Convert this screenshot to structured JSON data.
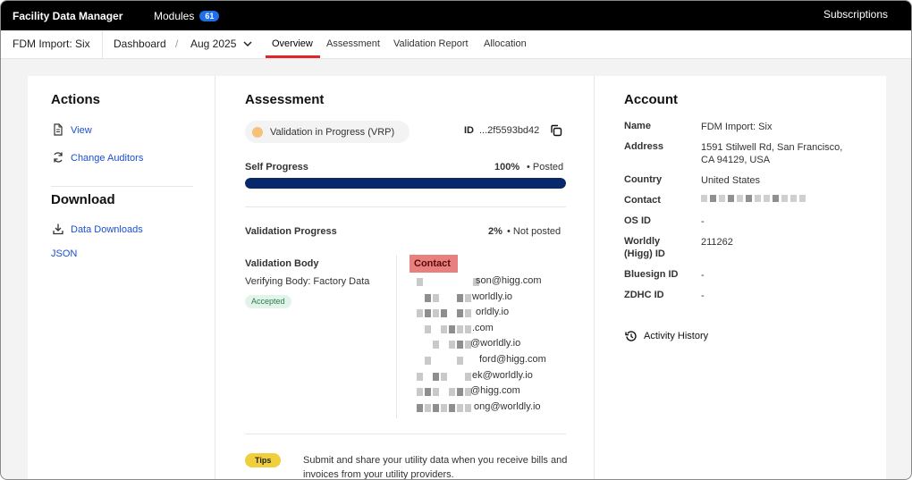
{
  "topbar": {
    "brand": "Facility Data Manager",
    "modules_label": "Modules",
    "modules_count": "61",
    "subscriptions": "Subscriptions"
  },
  "nav": {
    "facility": "FDM Import: Six",
    "dashboard": "Dashboard",
    "separator": "/",
    "month": "Aug 2025",
    "tabs": [
      {
        "label": "Overview"
      },
      {
        "label": "Assessment"
      },
      {
        "label": "Validation Report"
      },
      {
        "label": "Allocation"
      }
    ]
  },
  "actions": {
    "title": "Actions",
    "view": "View",
    "change_auditors": "Change Auditors"
  },
  "download": {
    "title": "Download",
    "data_downloads": "Data Downloads",
    "json": "JSON"
  },
  "assessment": {
    "title": "Assessment",
    "status": "Validation in Progress (VRP)",
    "id_label": "ID",
    "id_value": "...2f5593bd42",
    "self_progress_label": "Self Progress",
    "self_progress_pct": "100%",
    "self_progress_status": "• Posted",
    "self_progress_value": 1.0,
    "validation_progress_label": "Validation Progress",
    "validation_progress_pct": "2%",
    "validation_progress_status": "• Not posted",
    "validation_body_label": "Validation Body",
    "verifying_body": "Verifying Body: Factory Data",
    "accepted": "Accepted",
    "contact_header": "Contact",
    "contacts": [
      "son@higg.com",
      "worldly.io",
      "orldly.io",
      ".com",
      "@worldly.io",
      "ford@higg.com",
      "ek@worldly.io",
      "@higg.com",
      "ong@worldly.io"
    ],
    "tips_badge": "Tips",
    "tips_text": "Submit and share your utility data when you receive bills and invoices from your utility providers."
  },
  "account": {
    "title": "Account",
    "name_label": "Name",
    "name": "FDM Import: Six",
    "address_label": "Address",
    "address_line1": "1591 Stilwell Rd, San Francisco,",
    "address_line2": "CA 94129, USA",
    "country_label": "Country",
    "country": "United States",
    "contact_label": "Contact",
    "os_id_label": "OS ID",
    "os_id": "-",
    "worldly_id_label1": "Worldly",
    "worldly_id_label2": "(Higg) ID",
    "worldly_id": "211262",
    "bluesign_label": "Bluesign ID",
    "bluesign": "-",
    "zdhc_label": "ZDHC ID",
    "zdhc": "-",
    "activity_history": "Activity History"
  }
}
